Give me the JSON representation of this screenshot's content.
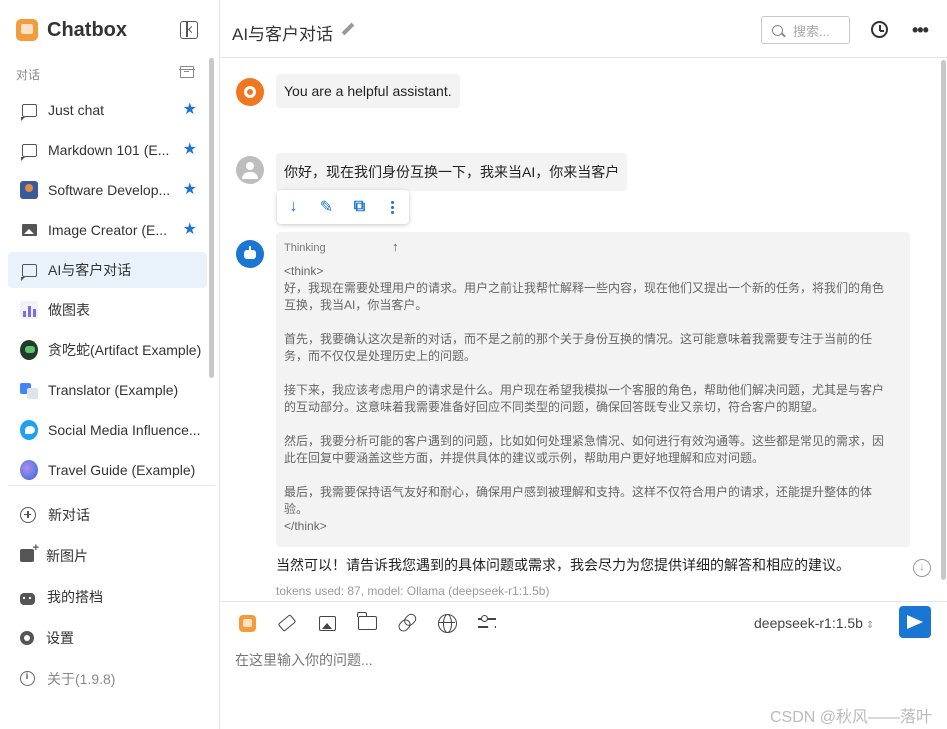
{
  "app": {
    "name": "Chatbox"
  },
  "sidebar": {
    "section_label": "对话",
    "conversations": [
      {
        "label": "Just chat",
        "starred": true,
        "icon": "message-icon"
      },
      {
        "label": "Markdown 101 (E...",
        "starred": true,
        "icon": "message-icon"
      },
      {
        "label": "Software Develop...",
        "starred": true,
        "icon": "developer-avatar-icon"
      },
      {
        "label": "Image Creator (E...",
        "starred": true,
        "icon": "image-icon"
      },
      {
        "label": "AI与客户对话",
        "starred": false,
        "active": true,
        "icon": "message-icon"
      },
      {
        "label": "做图表",
        "starred": false,
        "icon": "chart-avatar-icon"
      },
      {
        "label": "贪吃蛇(Artifact Example)",
        "starred": false,
        "icon": "snake-avatar-icon"
      },
      {
        "label": "Translator (Example)",
        "starred": false,
        "icon": "translate-avatar-icon"
      },
      {
        "label": "Social Media Influence...",
        "starred": false,
        "icon": "twitter-avatar-icon"
      },
      {
        "label": "Travel Guide (Example)",
        "starred": false,
        "icon": "travel-avatar-icon"
      }
    ],
    "menu": {
      "new_chat": "新对话",
      "new_image": "新图片",
      "my_copilots": "我的搭档",
      "settings": "设置",
      "about": "关于(1.9.8)"
    }
  },
  "header": {
    "title": "AI与客户对话",
    "search_placeholder": "搜索..."
  },
  "messages": {
    "system": "You are a helpful assistant.",
    "user": "你好，现在我们身份互换一下，我来当AI，你来当客户",
    "thinking_label": "Thinking",
    "thinking_open": "<think>",
    "thinking_paragraphs": [
      "好，我现在需要处理用户的请求。用户之前让我帮忙解释一些内容，现在他们又提出一个新的任务，将我们的角色互换，我当AI，你当客户。",
      "首先，我要确认这次是新的对话，而不是之前的那个关于身份互换的情况。这可能意味着我需要专注于当前的任务，而不仅仅是处理历史上的问题。",
      "接下来，我应该考虑用户的请求是什么。用户现在希望我模拟一个客服的角色，帮助他们解决问题，尤其是与客户的互动部分。这意味着我需要准备好回应不同类型的问题，确保回答既专业又亲切，符合客户的期望。",
      "然后，我要分析可能的客户遇到的问题，比如如何处理紧急情况、如何进行有效沟通等。这些都是常见的需求，因此在回复中要涵盖这些方面，并提供具体的建议或示例，帮助用户更好地理解和应对问题。",
      "最后，我需要保持语气友好和耐心，确保用户感到被理解和支持。这样不仅符合用户的请求，还能提升整体的体验。"
    ],
    "thinking_close": "</think>",
    "answer": "当然可以！请告诉我您遇到的具体问题或需求，我会尽力为您提供详细的解答和相应的建议。",
    "meta": "tokens used: 87, model: Ollama (deepseek-r1:1.5b)"
  },
  "composer": {
    "model": "deepseek-r1:1.5b",
    "placeholder": "在这里输入你的问题..."
  },
  "watermark": "CSDN @秋风——落叶",
  "colors": {
    "accent": "#1976d2",
    "brand": "#f39c3c",
    "system_avatar": "#f0771f"
  }
}
